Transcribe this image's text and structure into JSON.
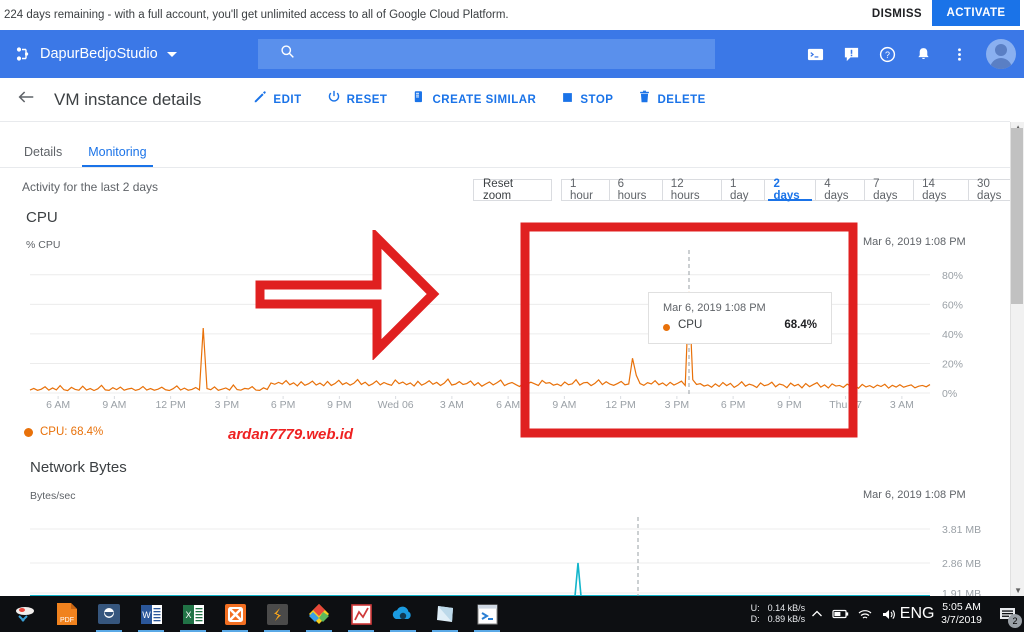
{
  "promo": {
    "message": "224 days remaining - with a full account, you'll get unlimited access to all of Google Cloud Platform.",
    "dismiss_label": "DISMISS",
    "activate_label": "ACTIVATE",
    "activate_color": "#1a73e8"
  },
  "appbar": {
    "project_name": "DapurBedjoStudio",
    "search_placeholder": "",
    "icons": [
      "cloud-shell-icon",
      "feedback-icon",
      "help-icon",
      "notifications-icon",
      "more-vert-icon",
      "avatar"
    ]
  },
  "toolbar": {
    "title": "VM instance details",
    "actions": [
      {
        "label": "EDIT",
        "icon": "pencil-icon"
      },
      {
        "label": "RESET",
        "icon": "power-reset-icon"
      },
      {
        "label": "CREATE SIMILAR",
        "icon": "copy-icon"
      },
      {
        "label": "STOP",
        "icon": "stop-square-icon"
      },
      {
        "label": "DELETE",
        "icon": "trash-icon"
      }
    ]
  },
  "tabs": [
    {
      "label": "Details",
      "active": false
    },
    {
      "label": "Monitoring",
      "active": true
    }
  ],
  "activity": {
    "text": "Activity for the last 2 days",
    "reset_zoom_label": "Reset zoom",
    "ranges": [
      {
        "label": "1 hour",
        "active": false
      },
      {
        "label": "6 hours",
        "active": false
      },
      {
        "label": "12 hours",
        "active": false
      },
      {
        "label": "1 day",
        "active": false
      },
      {
        "label": "2 days",
        "active": true
      },
      {
        "label": "4 days",
        "active": false
      },
      {
        "label": "7 days",
        "active": false
      },
      {
        "label": "14 days",
        "active": false
      },
      {
        "label": "30 days",
        "active": false
      }
    ]
  },
  "cpu_chart": {
    "title": "CPU",
    "axis_label": "% CPU",
    "timestamp": "Mar 6, 2019 1:08 PM",
    "legend": {
      "label": "CPU: 68.4%",
      "color": "#e8710a"
    },
    "tooltip": {
      "time": "Mar 6, 2019 1:08 PM",
      "series": "CPU",
      "value": "68.4%"
    }
  },
  "network_chart": {
    "title": "Network Bytes",
    "axis_label": "Bytes/sec",
    "timestamp": "Mar 6, 2019 1:08 PM"
  },
  "watermark": "ardan7779.web.id",
  "annotations": {
    "arrow_color": "#e02020",
    "box_color": "#e02020"
  },
  "taskbar": {
    "apps": [
      "snipping-tool-icon",
      "pdf-icon",
      "browser-icon",
      "word-icon",
      "excel-icon",
      "xampp-icon",
      "sublime-icon",
      "colorful-diamond-icon",
      "red-chart-icon",
      "cloud-blue-icon",
      "notepad-icon",
      "terminal-icon"
    ],
    "tray": {
      "upload_label": "U:",
      "upload_value": "0.14 kB/s",
      "download_label": "D:",
      "download_value": "0.89 kB/s",
      "language": "ENG",
      "time": "5:05 AM",
      "date": "3/7/2019",
      "notification_count": "2"
    }
  },
  "chart_data": {
    "type": "line",
    "title": "CPU",
    "xlabel": "",
    "ylabel": "% CPU",
    "ylim": [
      0,
      90
    ],
    "yticks": [
      "0%",
      "20%",
      "40%",
      "60%",
      "80%"
    ],
    "ytick_values": [
      0,
      20,
      40,
      60,
      80
    ],
    "grid": true,
    "legend_position": "below",
    "xticks": [
      "6 AM",
      "9 AM",
      "12 PM",
      "3 PM",
      "6 PM",
      "9 PM",
      "Wed 06",
      "3 AM",
      "6 AM",
      "9 AM",
      "12 PM",
      "3 PM",
      "6 PM",
      "9 PM",
      "Thu 07",
      "3 AM"
    ],
    "cursor_time": "Mar 6, 2019 1:08 PM",
    "cursor_value": 68.4,
    "series": [
      {
        "name": "CPU",
        "color": "#e8710a",
        "unit": "%",
        "values": [
          2.0,
          3.1,
          1.8,
          2.6,
          4.2,
          1.9,
          3.4,
          2.1,
          5.0,
          2.2,
          1.6,
          3.8,
          2.4,
          1.9,
          4.6,
          2.0,
          3.0,
          1.7,
          2.8,
          5.2,
          2.1,
          1.8,
          3.6,
          2.3,
          4.0,
          1.9,
          2.7,
          3.2,
          1.8,
          2.5,
          4.4,
          2.0,
          3.0,
          1.9,
          2.6,
          3.9,
          2.2,
          1.7,
          2.9,
          4.8,
          2.0,
          3.3,
          1.9,
          2.4,
          3.7,
          2.1,
          44.0,
          3.0,
          2.2,
          4.1,
          1.8,
          2.6,
          3.4,
          2.0,
          5.4,
          2.3,
          1.9,
          3.1,
          2.7,
          4.3,
          2.0,
          1.8,
          3.5,
          2.4,
          6.8,
          5.9,
          7.2,
          6.1,
          8.4,
          5.6,
          6.9,
          4.8,
          7.6,
          5.2,
          6.3,
          8.0,
          5.4,
          6.7,
          4.9,
          7.8,
          5.1,
          6.4,
          8.6,
          5.7,
          7.0,
          5.3,
          6.6,
          9.1,
          5.8,
          7.3,
          5.0,
          6.2,
          8.2,
          5.5,
          7.1,
          6.0,
          5.2,
          8.8,
          6.3,
          7.4,
          5.6,
          6.8,
          4.7,
          7.9,
          5.3,
          6.5,
          8.3,
          5.9,
          7.2,
          5.1,
          6.7,
          9.4,
          5.4,
          6.0,
          7.7,
          5.8,
          6.4,
          8.1,
          5.2,
          7.0,
          4.6,
          6.1,
          7.5,
          5.5,
          6.9,
          8.7,
          5.0,
          6.3,
          7.1,
          5.7,
          4.4,
          6.8,
          5.9,
          7.3,
          6.2,
          5.1,
          8.5,
          6.6,
          7.0,
          5.3,
          6.1,
          4.8,
          7.4,
          5.6,
          6.2,
          9.0,
          5.4,
          6.9,
          7.2,
          5.0,
          6.5,
          8.9,
          5.7,
          7.6,
          6.0,
          5.2,
          6.4,
          7.8,
          5.5,
          6.1,
          23.5,
          12.0,
          6.4,
          5.2,
          7.0,
          6.1,
          8.3,
          5.6,
          6.8,
          4.9,
          7.2,
          5.4,
          6.6,
          8.0,
          5.1,
          68.4,
          9.0,
          5.8,
          6.3,
          4.7,
          5.5,
          3.9,
          6.2,
          4.4,
          7.1,
          5.0,
          6.5,
          3.8,
          5.3,
          7.6,
          4.6,
          6.0,
          5.2,
          3.7,
          6.8,
          4.9,
          5.6,
          7.3,
          4.2,
          6.1,
          5.4,
          3.6,
          6.7,
          4.8,
          5.9,
          3.5,
          6.4,
          4.3,
          5.7,
          7.0,
          4.0,
          5.5,
          3.4,
          6.2,
          4.7,
          5.1,
          3.8,
          6.0,
          4.5,
          5.3,
          3.2,
          5.8,
          4.1,
          5.0,
          3.6,
          5.4,
          4.4,
          5.9,
          3.3,
          5.2,
          4.0,
          5.6,
          3.9,
          4.8,
          5.5,
          3.5,
          4.6,
          5.1,
          4.2,
          5.7
        ]
      }
    ]
  },
  "network_chart_data": {
    "type": "line",
    "title": "Network Bytes",
    "ylabel": "Bytes/sec",
    "yticks": [
      "3.81 MB",
      "2.86 MB",
      "1.91 MB"
    ],
    "grid": true,
    "series": [
      {
        "name": "Network",
        "color": "#12b5cb",
        "spike_value": "2.86 MB"
      }
    ]
  }
}
